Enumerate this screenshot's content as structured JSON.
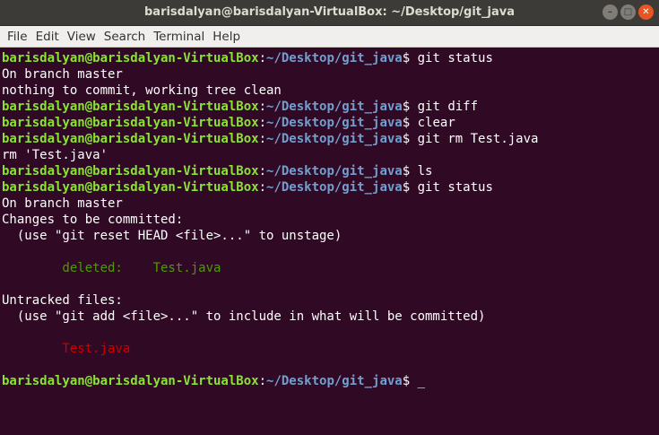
{
  "window": {
    "title": "barisdalyan@barisdalyan-VirtualBox: ~/Desktop/git_java",
    "buttons": {
      "minimize": "–",
      "maximize": "□",
      "close": "✕"
    }
  },
  "menu": [
    "File",
    "Edit",
    "View",
    "Search",
    "Terminal",
    "Help"
  ],
  "prompt": {
    "user_host": "barisdalyan@barisdalyan-VirtualBox",
    "colon": ":",
    "path": "~/Desktop/git_java",
    "dollar": "$"
  },
  "lines": [
    {
      "type": "prompt",
      "cmd": " git status"
    },
    {
      "type": "text",
      "text": "On branch master"
    },
    {
      "type": "text",
      "text": "nothing to commit, working tree clean"
    },
    {
      "type": "prompt",
      "cmd": " git diff"
    },
    {
      "type": "prompt",
      "cmd": " clear"
    },
    {
      "type": "prompt",
      "cmd": " git rm Test.java"
    },
    {
      "type": "text",
      "text": "rm 'Test.java'"
    },
    {
      "type": "prompt",
      "cmd": " ls"
    },
    {
      "type": "prompt",
      "cmd": " git status"
    },
    {
      "type": "text",
      "text": "On branch master"
    },
    {
      "type": "text",
      "text": "Changes to be committed:"
    },
    {
      "type": "text",
      "text": "  (use \"git reset HEAD <file>...\" to unstage)"
    },
    {
      "type": "blank"
    },
    {
      "type": "green",
      "text": "\tdeleted:    Test.java"
    },
    {
      "type": "blank"
    },
    {
      "type": "text",
      "text": "Untracked files:"
    },
    {
      "type": "text",
      "text": "  (use \"git add <file>...\" to include in what will be committed)"
    },
    {
      "type": "blank"
    },
    {
      "type": "red",
      "text": "\tTest.java"
    },
    {
      "type": "blank"
    },
    {
      "type": "prompt",
      "cmd": " ",
      "cursor": "_"
    }
  ],
  "colors": {
    "background": "#300a24",
    "user": "#8ae234",
    "path": "#729fcf",
    "staged": "#4e9a06",
    "untracked": "#cc0000"
  }
}
